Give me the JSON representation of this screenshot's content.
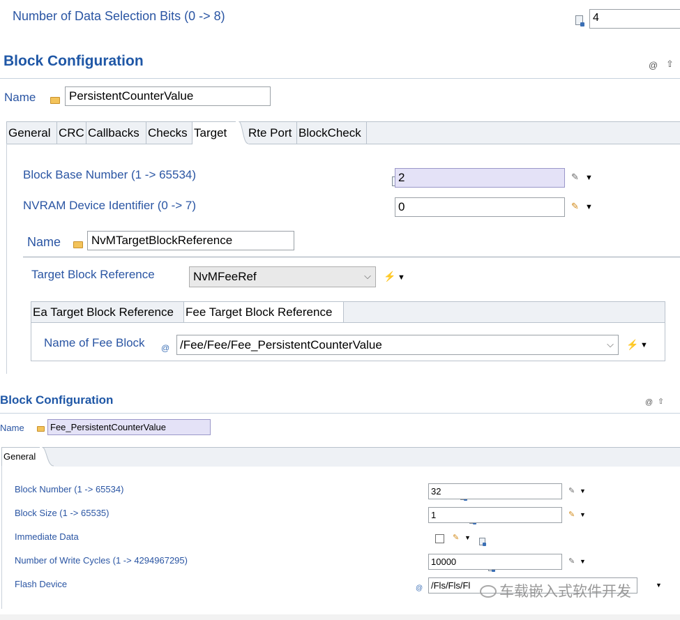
{
  "top": {
    "data_bits_label": "Number of Data Selection Bits (0 -> 8)",
    "data_bits_value": "4"
  },
  "block1": {
    "title": "Block Configuration",
    "name_label": "Name",
    "name_value": "PersistentCounterValue",
    "tabs": [
      "General",
      "CRC",
      "Callbacks",
      "Checks",
      "Target",
      "Rte Port",
      "BlockCheck"
    ],
    "active_tab": "Target",
    "base_number_label": "Block Base Number (1 -> 65534)",
    "base_number_value": "2",
    "device_id_label": "NVRAM Device Identifier (0 -> 7)",
    "device_id_value": "0",
    "target_name_label": "Name",
    "target_name_value": "NvMTargetBlockReference",
    "target_ref_label": "Target Block Reference",
    "target_ref_value": "NvMFeeRef",
    "subtabs": [
      "Ea Target Block Reference",
      "Fee Target Block Reference"
    ],
    "active_subtab": "Fee Target Block Reference",
    "fee_block_label": "Name of Fee Block",
    "fee_block_value": "/Fee/Fee/Fee_PersistentCounterValue"
  },
  "block2": {
    "title": "Block Configuration",
    "name_label": "Name",
    "name_value": "Fee_PersistentCounterValue",
    "tab": "General",
    "block_number_label": "Block Number (1 -> 65534)",
    "block_number_value": "32",
    "block_size_label": "Block Size (1 -> 65535)",
    "block_size_value": "1",
    "immediate_label": "Immediate Data",
    "immediate_checked": false,
    "write_cycles_label": "Number of Write Cycles (1 -> 4294967295)",
    "write_cycles_value": "10000",
    "flash_device_label": "Flash Device",
    "flash_device_value": "/Fls/Fls/Fl"
  },
  "watermark": "车载嵌入式软件开发",
  "colors": {
    "label": "#2a55a3",
    "header": "#1f57a6",
    "highlight_field": "#e4e2f7",
    "tab_bar": "#eef1f5"
  }
}
